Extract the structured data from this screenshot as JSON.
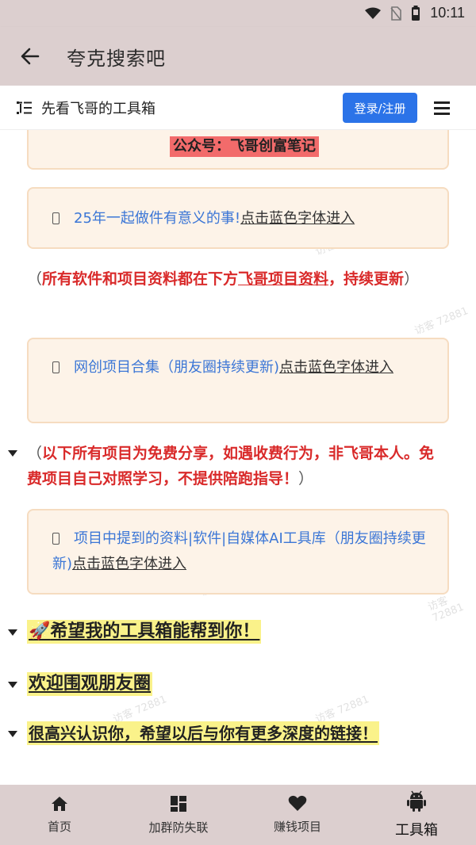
{
  "statusbar": {
    "time": "10:11"
  },
  "appbar": {
    "title": "夸克搜索吧"
  },
  "site_header": {
    "title": "先看飞哥的工具箱",
    "login_label": "登录/注册"
  },
  "content": {
    "card_top": {
      "text": "公众号：飞哥创富笔记"
    },
    "card_2": {
      "text": "25年一起做件有意义的事!",
      "link": "点击蓝色字体进入"
    },
    "note_1": {
      "open": "（",
      "text": "所有软件和项目资料都在下方",
      "link": "飞哥项目资料",
      "rest": "，持续更新",
      "close": "）"
    },
    "card_3": {
      "text": "网创项目合集（朋友圈持续更新)",
      "link": "点击蓝色字体进入"
    },
    "note_2": {
      "open": "（",
      "text": "以下所有项目为免费分享，如遇收费行为，非飞哥本人。免费项目自己对照学习，不提供陪跑指导！",
      "close": "）"
    },
    "card_4": {
      "text": "项目中提到的资料|软件|自媒体AI工具库（朋友圈持续更新)",
      "link": "点击蓝色字体进入"
    },
    "heading_1": {
      "emoji": "🚀",
      "text": "希望我的工具箱能帮到你！"
    },
    "heading_2": {
      "text": "欢迎围观朋友圈"
    },
    "heading_3": {
      "text": "很高兴认识你，希望以后与你有更多深度的链接！"
    },
    "watermark": "访客 72881"
  },
  "bottom_nav": [
    {
      "label": "首页",
      "icon": "home-icon",
      "active": false
    },
    {
      "label": "加群防失联",
      "icon": "grid-icon",
      "active": false
    },
    {
      "label": "赚钱项目",
      "icon": "heart-icon",
      "active": false
    },
    {
      "label": "工具箱",
      "icon": "android-icon",
      "active": true
    }
  ],
  "colors": {
    "bars": "#dccfcf",
    "accent_blue": "#2b73e8",
    "link_blue": "#3b76d6",
    "red": "#d92a2a",
    "highlight": "#faf28a",
    "card_bg": "#fdf3e8"
  }
}
